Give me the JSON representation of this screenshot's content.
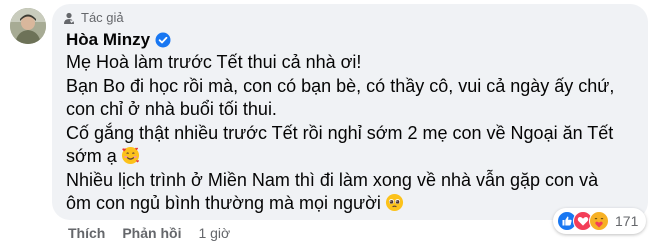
{
  "comment": {
    "author_label": "Tác giả",
    "author_name": "Hòa Minzy",
    "lines": [
      "Mẹ Hoà làm trước Tết thui cả nhà ơi!",
      "Bạn Bo đi học rồi mà, con có bạn bè, có thầy cô, vui cả ngày ấy chứ,",
      "con chỉ ở nhà buổi tối thui.",
      "Cố gắng thật nhiều trước Tết rồi nghỉ sớm 2 mẹ con về Ngoại ăn Tết",
      "sớm ạ",
      "Nhiều lịch trình ở Miền Nam thì đi làm xong về nhà vẫn gặp con và",
      "ôm con ngủ bình thường mà mọi người"
    ],
    "emojis": [
      "smiling-face-with-hearts",
      "pleading-face"
    ]
  },
  "actions": {
    "like_label": "Thích",
    "reply_label": "Phản hồi",
    "time": "1 giờ"
  },
  "reactions": {
    "icons": [
      "like-icon",
      "love-icon",
      "care-icon"
    ],
    "count": "171"
  },
  "colors": {
    "bubble": "#f0f2f5",
    "text": "#050505",
    "secondary": "#65676b",
    "verified": "#1877f2"
  }
}
